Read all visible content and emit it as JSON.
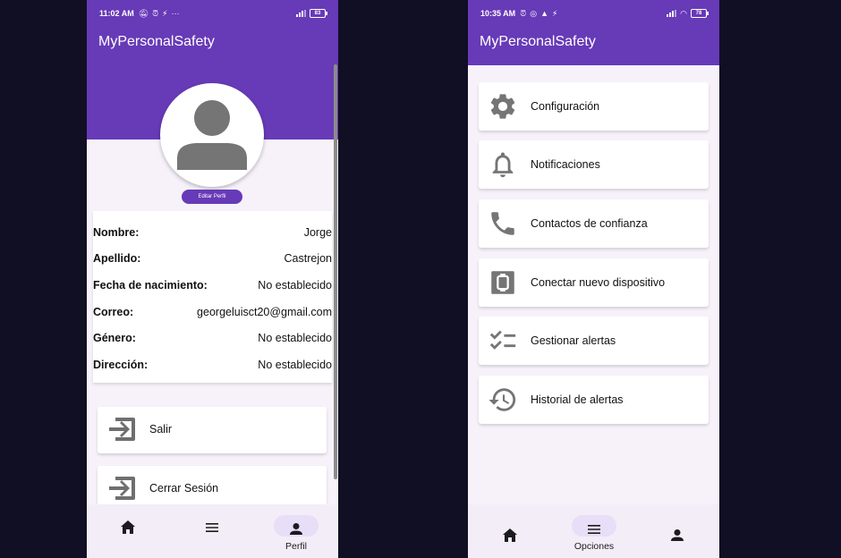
{
  "left": {
    "status": {
      "time": "11:02 AM",
      "more": "···",
      "battery": "83"
    },
    "app_title": "MyPersonalSafety",
    "edit_profile_label": "Editar Perfil",
    "fields": [
      {
        "label": "Nombre:",
        "value": "Jorge"
      },
      {
        "label": "Apellido:",
        "value": "Castrejon"
      },
      {
        "label": "Fecha de nacimiento:",
        "value": "No establecido"
      },
      {
        "label": "Correo:",
        "value": "georgeluisct20@gmail.com"
      },
      {
        "label": "Género:",
        "value": "No establecido"
      },
      {
        "label": "Dirección:",
        "value": "No establecido"
      }
    ],
    "actions": [
      {
        "label": "Salir",
        "icon": "exit-icon"
      },
      {
        "label": "Cerrar Sesión",
        "icon": "exit-icon"
      }
    ],
    "nav": [
      {
        "icon": "home-icon",
        "label": ""
      },
      {
        "icon": "menu-icon",
        "label": ""
      },
      {
        "icon": "person-icon",
        "label": "Perfil"
      }
    ]
  },
  "right": {
    "status": {
      "time": "10:35 AM",
      "battery": "78"
    },
    "app_title": "MyPersonalSafety",
    "options": [
      {
        "label": "Configuración",
        "icon": "gear-icon"
      },
      {
        "label": "Notificaciones",
        "icon": "bell-icon"
      },
      {
        "label": "Contactos de confianza",
        "icon": "phone-icon"
      },
      {
        "label": "Conectar nuevo dispositivo",
        "icon": "watch-icon"
      },
      {
        "label": "Gestionar alertas",
        "icon": "checklist-icon"
      },
      {
        "label": "Historial de alertas",
        "icon": "history-icon"
      }
    ],
    "nav": [
      {
        "icon": "home-icon",
        "label": ""
      },
      {
        "icon": "menu-icon",
        "label": "Opciones"
      },
      {
        "icon": "person-icon",
        "label": ""
      }
    ]
  },
  "colors": {
    "primary": "#673ab7",
    "pill": "#e8def8",
    "background": "#110f24",
    "icon": "#757575"
  }
}
